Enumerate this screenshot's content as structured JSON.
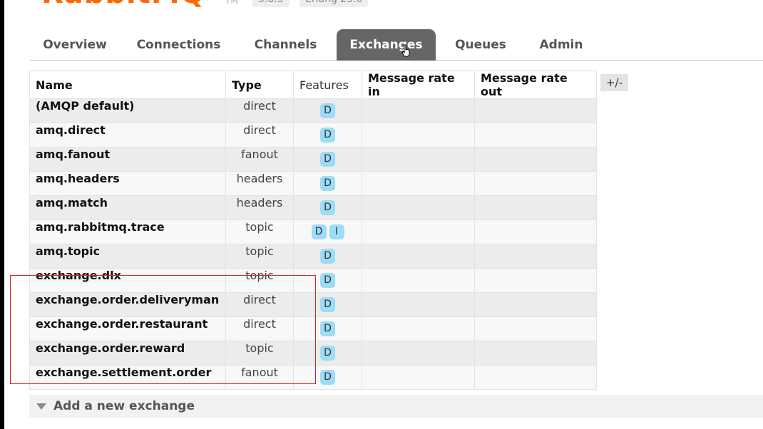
{
  "header": {
    "logo": "RabbitMQ",
    "tm": "TM",
    "version": "3.8.5",
    "erlang": "Erlang 23.0"
  },
  "tabs": [
    {
      "label": "Overview"
    },
    {
      "label": "Connections"
    },
    {
      "label": "Channels"
    },
    {
      "label": "Exchanges",
      "active": true
    },
    {
      "label": "Queues"
    },
    {
      "label": "Admin"
    }
  ],
  "table": {
    "columns": [
      "Name",
      "Type",
      "Features",
      "Message rate in",
      "Message rate out"
    ],
    "rows": [
      {
        "name": "(AMQP default)",
        "type": "direct",
        "features": [
          "D"
        ]
      },
      {
        "name": "amq.direct",
        "type": "direct",
        "features": [
          "D"
        ]
      },
      {
        "name": "amq.fanout",
        "type": "fanout",
        "features": [
          "D"
        ]
      },
      {
        "name": "amq.headers",
        "type": "headers",
        "features": [
          "D"
        ]
      },
      {
        "name": "amq.match",
        "type": "headers",
        "features": [
          "D"
        ]
      },
      {
        "name": "amq.rabbitmq.trace",
        "type": "topic",
        "features": [
          "D",
          "I"
        ]
      },
      {
        "name": "amq.topic",
        "type": "topic",
        "features": [
          "D"
        ]
      },
      {
        "name": "exchange.dlx",
        "type": "topic",
        "features": [
          "D"
        ]
      },
      {
        "name": "exchange.order.deliveryman",
        "type": "direct",
        "features": [
          "D"
        ]
      },
      {
        "name": "exchange.order.restaurant",
        "type": "direct",
        "features": [
          "D"
        ]
      },
      {
        "name": "exchange.order.reward",
        "type": "topic",
        "features": [
          "D"
        ]
      },
      {
        "name": "exchange.settlement.order",
        "type": "fanout",
        "features": [
          "D"
        ]
      }
    ],
    "column_toggle": "+/-"
  },
  "add_exchange": {
    "label": "Add a new exchange"
  },
  "colors": {
    "accent": "#ff6600",
    "active_tab": "#666666",
    "badge": "#9ddcf7",
    "highlight": "#dd2222"
  }
}
